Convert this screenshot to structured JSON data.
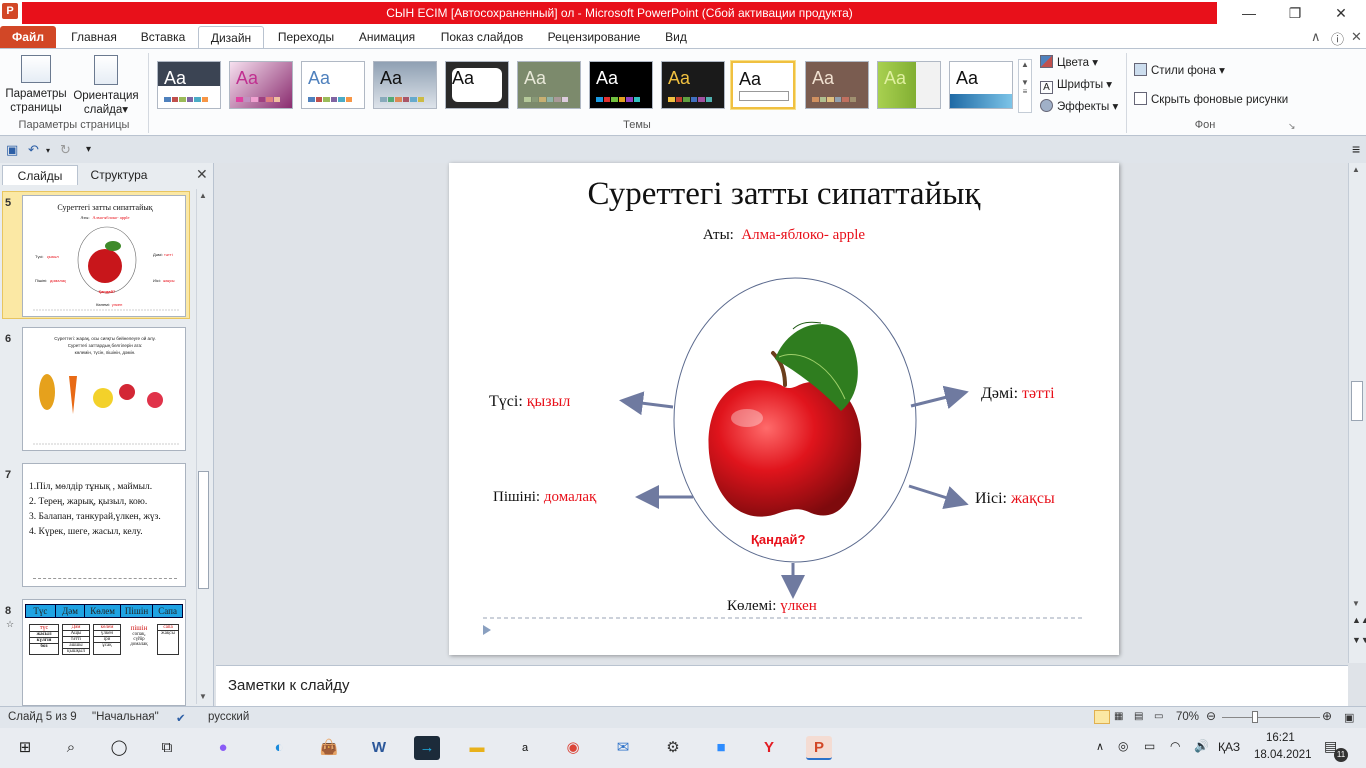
{
  "window": {
    "title": "СЫН ЕСІМ [Автосохраненный] ол  -  Microsoft PowerPoint (Сбой активации продукта)",
    "app_icon": "P"
  },
  "ribbon_tabs": [
    "Файл",
    "Главная",
    "Вставка",
    "Дизайн",
    "Переходы",
    "Анимация",
    "Показ слайдов",
    "Рецензирование",
    "Вид"
  ],
  "ribbon": {
    "page_setup": {
      "params_label": "Параметры страницы",
      "orientation_label": "Ориентация слайда",
      "group_label": "Параметры страницы"
    },
    "themes_label": "Темы",
    "theme_aa": "Aa",
    "colors_label": "Цвета",
    "fonts_label": "Шрифты",
    "effects_label": "Эффекты",
    "bg_styles_label": "Стили фона",
    "hide_bg_label": "Скрыть фоновые рисунки",
    "bg_group_label": "Фон",
    "accent": "#d24726"
  },
  "left_panel": {
    "tab_slides": "Слайды",
    "tab_outline": "Структура",
    "slide_numbers": [
      "5",
      "6",
      "7",
      "8"
    ],
    "slide5": {
      "title": "Суреттегі  затты сипаттайық",
      "sub_label": "Аты:",
      "sub_value": "Алма-яблоко- apple",
      "l1": "Түсі:",
      "v1": "қызыл",
      "l2": "Дәмі:",
      "v2": "тәтті",
      "l3": "Пішіні:",
      "v3": "домалақ",
      "l4": "Иісі:",
      "v4": "жақсы",
      "q": "Қандай?",
      "l5": "Көлемі:",
      "v5": "үлкен"
    },
    "slide6_lines": [
      "Суреттегі: жарақ, осы сияқты бейнелеуге ой алу.",
      "Суреттегі заттардың белгілерін ата:",
      "көлемін, түсін, пішінін, дәмін."
    ],
    "slide7_lines": [
      "1.Піл, мөлдір тұнық , маймыл.",
      "2. Терең, жарық, қызыл, кою.",
      "3.  Балапан, танкурай,үлкен, жүз.",
      "4.  Күрек, шеге, жасыл, келу."
    ],
    "slide8": {
      "headers": [
        "Түс",
        "Дәм",
        "Көлем",
        "Пішін",
        "Сапа"
      ],
      "col1": [
        "түс",
        "жасыл",
        "күлгін",
        "боз"
      ],
      "col2": [
        "Дәм",
        "Ащы",
        "тәтті",
        "ашшы",
        "қышқыл"
      ],
      "col3": [
        "көлем",
        "үлкен",
        "іри",
        "ұсақ"
      ],
      "col4": [
        "пішін",
        "сопақ,",
        "сүйір",
        "домалақ"
      ],
      "col5": [
        "сапа",
        "жақсы"
      ]
    }
  },
  "slide": {
    "title": "Суреттегі  затты сипаттайық",
    "name_label": "Аты:",
    "name_value": "Алма-яблоко- apple",
    "color_label": "Түсі:",
    "color_value": "қызыл",
    "taste_label": "Дәмі:",
    "taste_value": "тәтті",
    "shape_label": "Пішіні:",
    "shape_value": "домалақ",
    "smell_label": "Иісі:",
    "smell_value": "жақсы",
    "question": "Қандай?",
    "size_label": "Көлемі:",
    "size_value": "үлкен"
  },
  "notes_placeholder": "Заметки к слайду",
  "status": {
    "slide_info": "Слайд 5 из 9",
    "theme": "\"Начальная\"",
    "language": "русский",
    "zoom": "70%"
  },
  "taskbar": {
    "lang": "ҚАЗ",
    "time": "16:21",
    "date": "18.04.2021",
    "notif_count": "11"
  }
}
